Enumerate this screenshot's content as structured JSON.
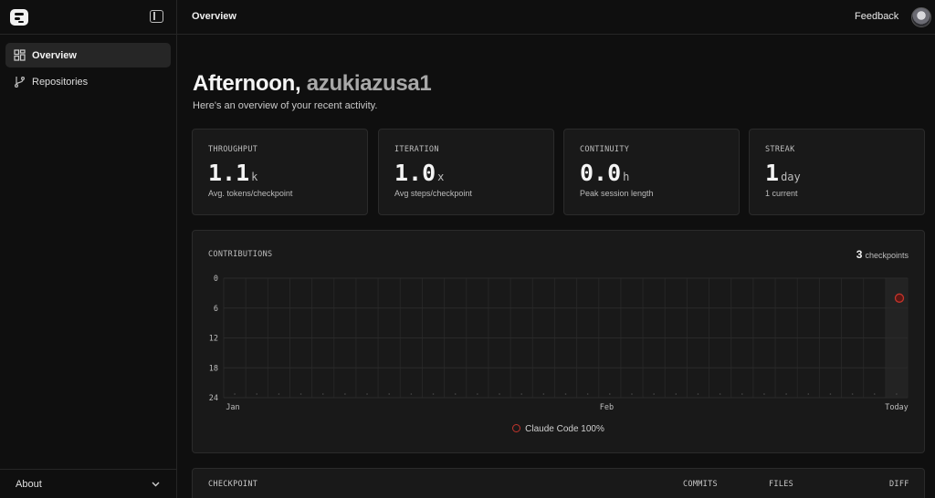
{
  "sidebar": {
    "items": [
      {
        "label": "Overview",
        "icon": "grid-icon",
        "active": true
      },
      {
        "label": "Repositories",
        "icon": "git-branch-icon",
        "active": false
      }
    ],
    "bottom_label": "About"
  },
  "header": {
    "title": "Overview",
    "feedback_label": "Feedback"
  },
  "greeting": {
    "prefix": "Afternoon,",
    "username": "azukiazusa1",
    "subtitle": "Here's an overview of your recent activity."
  },
  "stats": [
    {
      "label": "THROUGHPUT",
      "value": "1.1",
      "unit": "k",
      "desc": "Avg. tokens/checkpoint"
    },
    {
      "label": "ITERATION",
      "value": "1.0",
      "unit": "x",
      "desc": "Avg steps/checkpoint"
    },
    {
      "label": "CONTINUITY",
      "value": "0.0",
      "unit": "h",
      "desc": "Peak session length"
    },
    {
      "label": "STREAK",
      "value": "1",
      "unit": "day",
      "desc": "1 current"
    }
  ],
  "contributions": {
    "title": "CONTRIBUTIONS",
    "count": "3",
    "count_label": "checkpoints",
    "legend": "Claude Code 100%"
  },
  "chart_data": {
    "type": "scatter",
    "title": "CONTRIBUTIONS",
    "y_ticks": [
      "0",
      "6",
      "12",
      "18",
      "24"
    ],
    "x_ticks": [
      "Jan",
      "Feb",
      "Today"
    ],
    "ylim": [
      0,
      24
    ],
    "y_inverted": true,
    "grid": true,
    "series": [
      {
        "name": "Claude Code 100%",
        "color": "#c2352c",
        "points": [
          {
            "x": "Today",
            "y": 4
          }
        ]
      }
    ]
  },
  "table": {
    "headers": [
      "CHECKPOINT",
      "COMMITS",
      "FILES",
      "DIFF"
    ]
  },
  "colors": {
    "background": "#0f0f0f",
    "card": "#191919",
    "accent": "#c2352c"
  }
}
